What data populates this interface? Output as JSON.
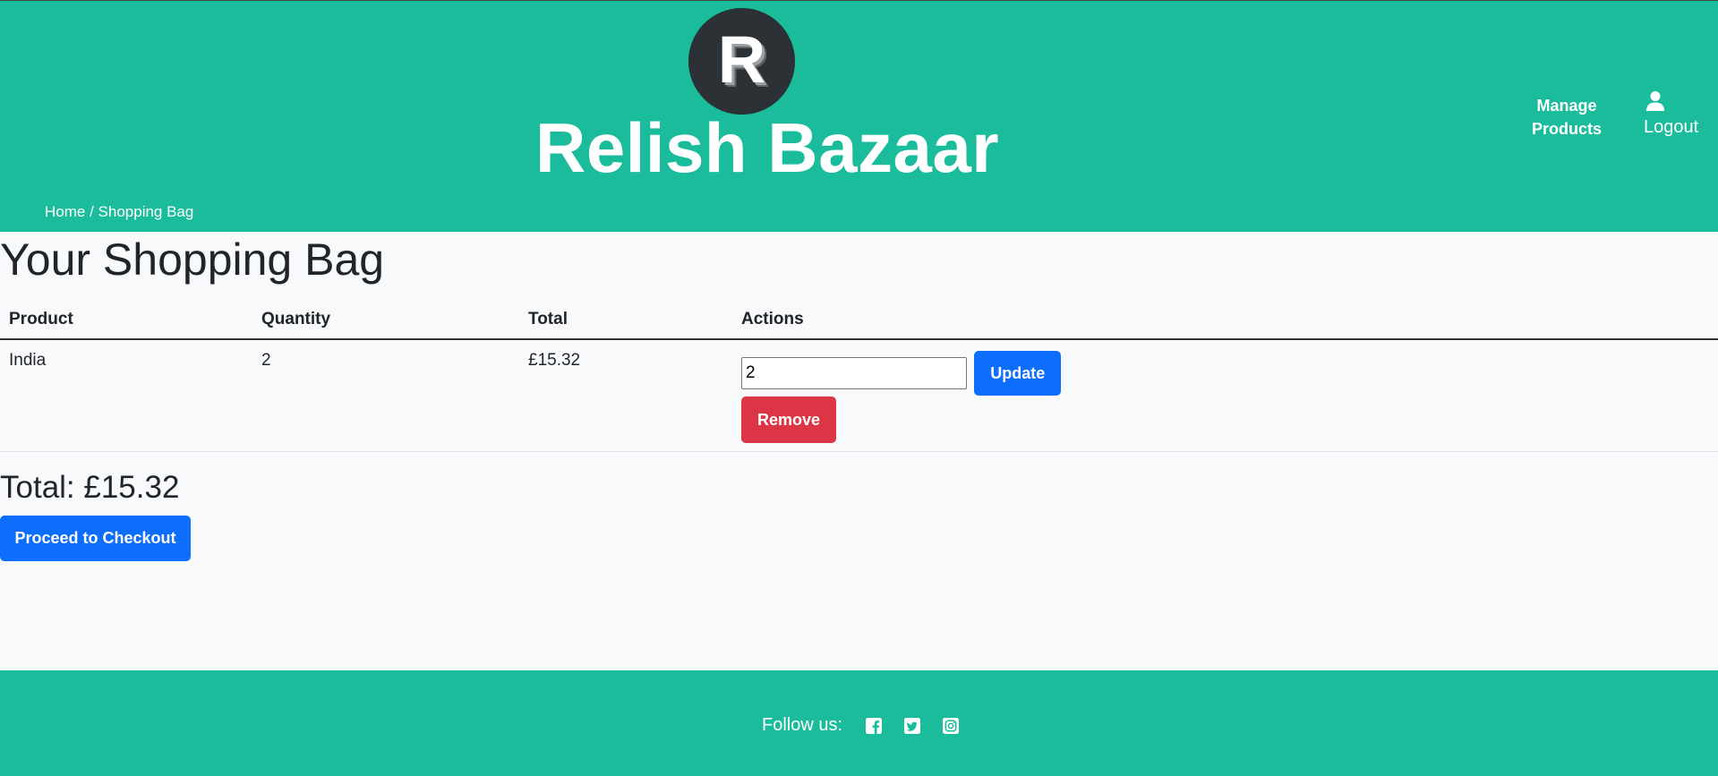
{
  "header": {
    "logo_letter": "R",
    "brand_name": "Relish Bazaar",
    "nav": {
      "manage_products": "Manage Products",
      "logout": "Logout"
    },
    "breadcrumb": {
      "home": "Home",
      "separator": " / ",
      "current": "Shopping Bag"
    }
  },
  "main": {
    "title": "Your Shopping Bag",
    "table": {
      "columns": [
        "Product",
        "Quantity",
        "Total",
        "Actions"
      ],
      "rows": [
        {
          "product": "India",
          "quantity": "2",
          "total": "£15.32",
          "quantity_input_value": "2",
          "update_label": "Update",
          "remove_label": "Remove"
        }
      ]
    },
    "grand_total": "Total: £15.32",
    "checkout_label": "Proceed to Checkout"
  },
  "footer": {
    "follow_label": "Follow us:",
    "social_icons": [
      "facebook-icon",
      "twitter-icon",
      "instagram-icon"
    ]
  },
  "colors": {
    "brand_teal": "#1abc9c",
    "primary_blue": "#0d6efd",
    "danger_red": "#dc3545",
    "page_background": "#f8f9fa"
  }
}
